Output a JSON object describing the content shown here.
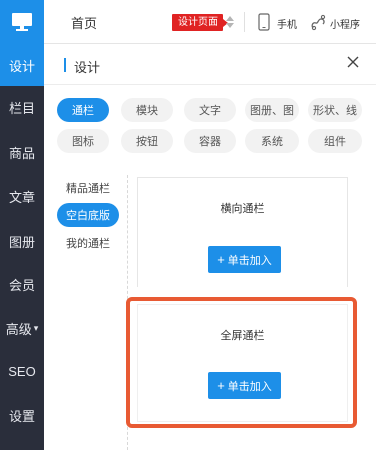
{
  "sidebar": {
    "logo_icon": "monitor-icon",
    "items": [
      {
        "label": "设计",
        "active": true
      },
      {
        "label": "栏目"
      },
      {
        "label": "商品"
      },
      {
        "label": "文章"
      },
      {
        "label": "图册"
      },
      {
        "label": "会员"
      },
      {
        "label": "高级",
        "has_caret": true,
        "caret": "▾"
      },
      {
        "label": "SEO"
      },
      {
        "label": "设置"
      }
    ]
  },
  "topbar": {
    "home_label": "首页",
    "design_tag": "设计页面",
    "phone_label": "手机",
    "mini_label": "小程序"
  },
  "panel": {
    "title": "设计",
    "close_icon": "close-icon"
  },
  "categories": [
    {
      "label": "通栏",
      "active": true
    },
    {
      "label": "模块"
    },
    {
      "label": "文字"
    },
    {
      "label": "图册、图"
    },
    {
      "label": "形状、线"
    },
    {
      "label": "图标"
    },
    {
      "label": "按钮"
    },
    {
      "label": "容器"
    },
    {
      "label": "系统"
    },
    {
      "label": "组件"
    }
  ],
  "sub_list": [
    {
      "label": "精品通栏"
    },
    {
      "label": "空白底版",
      "active": true
    },
    {
      "label": "我的通栏"
    }
  ],
  "cards": [
    {
      "title": "横向通栏",
      "button": "单击加入"
    },
    {
      "title": "全屏通栏",
      "button": "单击加入"
    }
  ],
  "colors": {
    "accent": "#1d8fe8",
    "sidebar_bg": "#2a2e3b",
    "tag_red": "#e02323",
    "highlight_orange": "#e85a33"
  }
}
